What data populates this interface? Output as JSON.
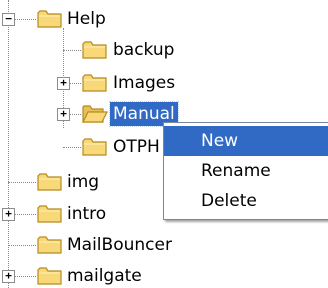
{
  "tree": {
    "nodes": [
      {
        "label": "Help",
        "expander": "−",
        "selected": false
      },
      {
        "label": "backup",
        "expander": "",
        "selected": false
      },
      {
        "label": "Images",
        "expander": "+",
        "selected": false
      },
      {
        "label": "Manual",
        "expander": "+",
        "selected": true
      },
      {
        "label": "OTPH",
        "expander": "",
        "selected": false
      },
      {
        "label": "img",
        "expander": "",
        "selected": false
      },
      {
        "label": "intro",
        "expander": "+",
        "selected": false
      },
      {
        "label": "MailBouncer",
        "expander": "",
        "selected": false
      },
      {
        "label": "mailgate",
        "expander": "+",
        "selected": false
      }
    ]
  },
  "context_menu": {
    "items": [
      "New",
      "Rename",
      "Delete"
    ],
    "highlighted": "New"
  },
  "colors": {
    "selection": "#316ac5",
    "folder_fill": "#f8d878",
    "folder_edge": "#b58b1e"
  }
}
